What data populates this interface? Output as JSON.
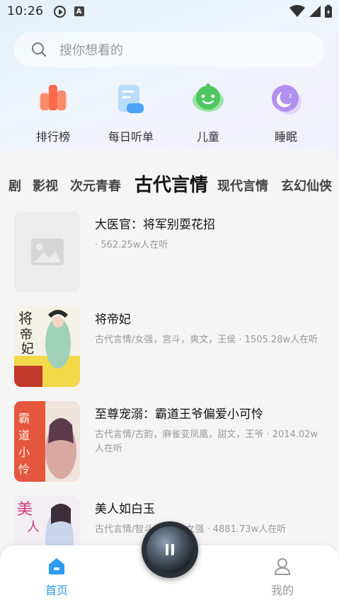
{
  "status": {
    "time": "10:26"
  },
  "search": {
    "placeholder": "搜你想看的"
  },
  "quick_links": [
    {
      "label": "排行榜",
      "icon": "ranking-icon"
    },
    {
      "label": "每日听单",
      "icon": "daily-list-icon"
    },
    {
      "label": "儿童",
      "icon": "kids-icon"
    },
    {
      "label": "睡眠",
      "icon": "sleep-icon"
    }
  ],
  "category_tabs": [
    "剧",
    "影视",
    "次元青春",
    "古代言情",
    "现代言情",
    "玄幻仙侠"
  ],
  "active_category": "古代言情",
  "books": [
    {
      "title": "大医官：将军别耍花招",
      "meta": " · 562.25w人在听",
      "cover": "placeholder"
    },
    {
      "title": "将帝妃",
      "meta": "古代言情/女强，宫斗，爽文，王侯 · 1505.28w人在听",
      "cover": "jiangdifei"
    },
    {
      "title": "至尊宠溺：霸道王爷偏爱小可怜",
      "meta": "古代言情/古韵，麻雀变凤凰，甜文，王爷 · 2014.02w人在听",
      "cover": "zhizunchongni"
    },
    {
      "title": "美人如白玉",
      "meta": "古代言情/智斗 · · · 身 女强 · 4881.73w人在听",
      "cover": "meirenrubaiyu"
    }
  ],
  "bottom_nav": {
    "home_label": "首页",
    "mine_label": "我的",
    "active_color": "#2e9bf0",
    "inactive_color": "#999999"
  }
}
